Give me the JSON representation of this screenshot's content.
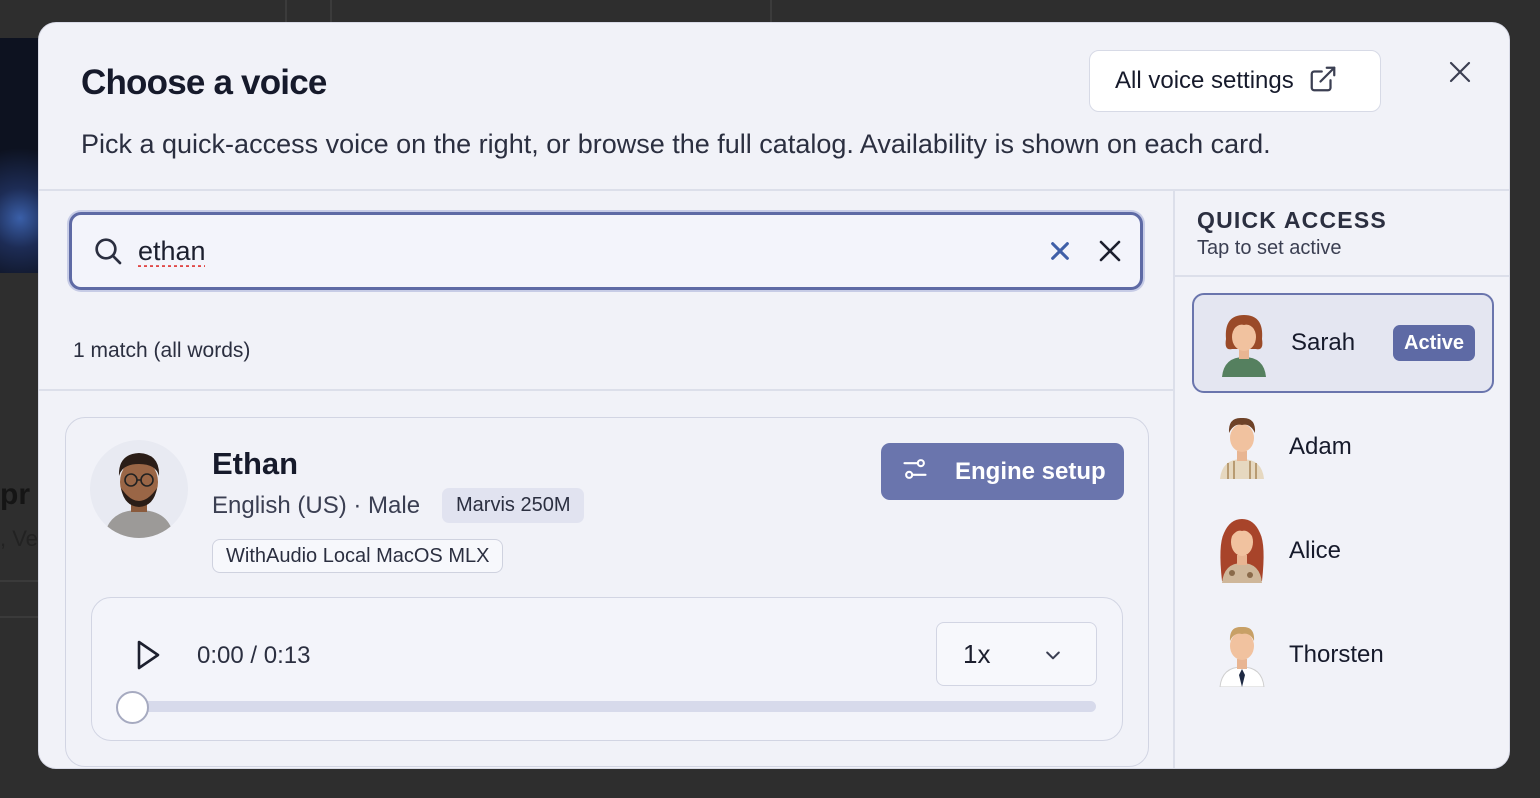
{
  "background": {
    "heading_fragment": "pr",
    "text_fragment": ", Ve"
  },
  "modal": {
    "title": "Choose a voice",
    "subtitle": "Pick a quick-access voice on the right, or browse the full catalog. Availability is shown on each card.",
    "settings_button": "All voice settings",
    "settings_icon": "external-link-icon",
    "close_icon": "close-icon"
  },
  "search": {
    "value": "ethan",
    "match_count": "1 match (all words)"
  },
  "voice_card": {
    "name": "Ethan",
    "meta": "English (US) · Male",
    "model": "Marvis 250M",
    "engine": "WithAudio Local MacOS MLX",
    "engine_button": "Engine setup",
    "player": {
      "time": "0:00 / 0:13",
      "speed": "1x",
      "progress": 0
    }
  },
  "quick_access": {
    "title": "QUICK ACCESS",
    "subtitle": "Tap to set active",
    "active_label": "Active",
    "items": [
      {
        "name": "Sarah",
        "active": true
      },
      {
        "name": "Adam",
        "active": false
      },
      {
        "name": "Alice",
        "active": false
      },
      {
        "name": "Thorsten",
        "active": false
      }
    ]
  },
  "colors": {
    "accent": "#5e6aa5",
    "button": "#6a75ad",
    "modal_bg": "#f1f2f8"
  }
}
